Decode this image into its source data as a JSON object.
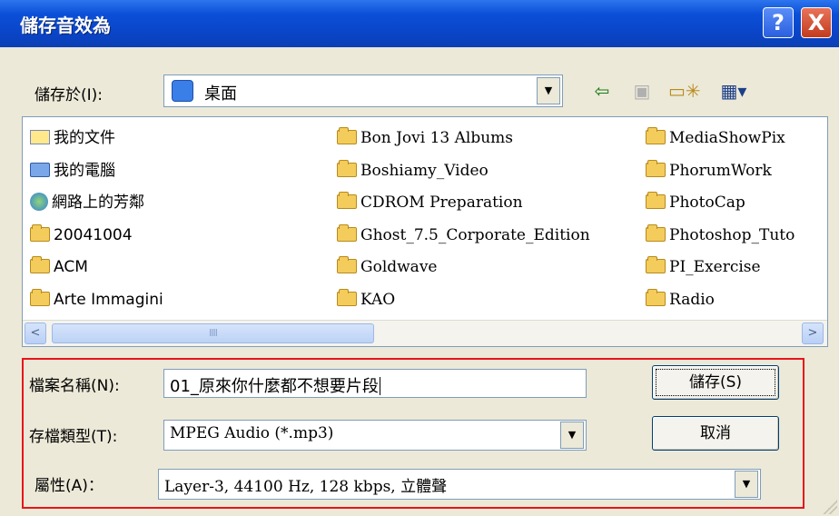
{
  "title": "儲存音效為",
  "title_buttons": {
    "help": "?",
    "close": "X"
  },
  "lookin": {
    "label": "儲存於(I):",
    "value": "桌面",
    "dropdown": "▼"
  },
  "toolbar": {
    "back_icon": "back-arrow-icon",
    "up_icon": "up-folder-icon",
    "new_folder_icon": "new-folder-icon",
    "view_icon": "view-menu-icon"
  },
  "files": {
    "col1": [
      {
        "name": "我的文件",
        "icon": "my-documents-icon"
      },
      {
        "name": "我的電腦",
        "icon": "my-computer-icon"
      },
      {
        "name": "網路上的芳鄰",
        "icon": "network-places-icon"
      },
      {
        "name": "20041004",
        "icon": "folder-icon"
      },
      {
        "name": "ACM",
        "icon": "folder-icon"
      },
      {
        "name": "Arte Immagini",
        "icon": "folder-icon"
      }
    ],
    "col2": [
      {
        "name": "Bon Jovi 13 Albums",
        "icon": "folder-icon"
      },
      {
        "name": "Boshiamy_Video",
        "icon": "folder-icon"
      },
      {
        "name": "CDROM Preparation",
        "icon": "folder-icon"
      },
      {
        "name": "Ghost_7.5_Corporate_Edition",
        "icon": "folder-icon"
      },
      {
        "name": "Goldwave",
        "icon": "folder-icon"
      },
      {
        "name": "KAO",
        "icon": "folder-icon"
      }
    ],
    "col3": [
      {
        "name": "MediaShowPix",
        "icon": "folder-icon"
      },
      {
        "name": "PhorumWork",
        "icon": "folder-icon"
      },
      {
        "name": "PhotoCap",
        "icon": "folder-icon"
      },
      {
        "name": "Photoshop_Tuto",
        "icon": "folder-icon"
      },
      {
        "name": "PI_Exercise",
        "icon": "folder-icon"
      },
      {
        "name": "Radio",
        "icon": "folder-icon"
      }
    ]
  },
  "scrollbar": {
    "left": "<",
    "right": ">",
    "thumb_grip": "IIII"
  },
  "filename": {
    "label": "檔案名稱(N):",
    "value": "01_原來你什麼都不想要片段"
  },
  "filetype": {
    "label": "存檔類型(T):",
    "value": "MPEG Audio (*.mp3)",
    "dropdown": "▼"
  },
  "attributes": {
    "label": "屬性(A)：",
    "value": "Layer-3, 44100 Hz, 128 kbps, 立體聲",
    "dropdown": "▼"
  },
  "buttons": {
    "save": "儲存(S)",
    "cancel": "取消"
  },
  "colors": {
    "titlebar": "#0a45c8",
    "highlight_box": "#e8141b",
    "dialog_bg": "#ece9d8"
  }
}
